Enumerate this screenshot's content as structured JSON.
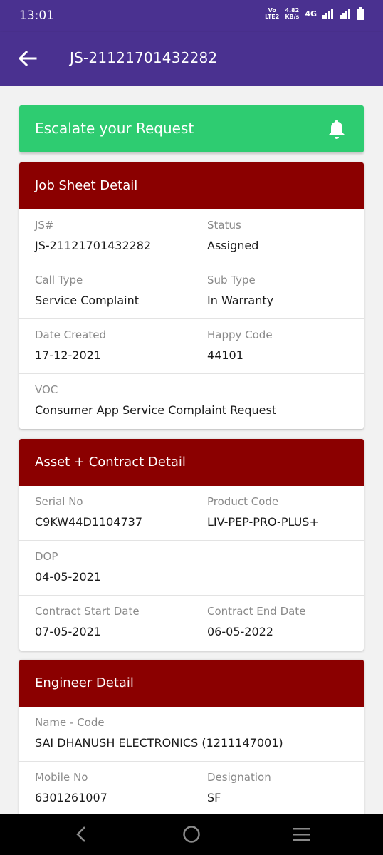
{
  "status_bar": {
    "time": "13:01",
    "volte_line1": "Vo",
    "volte_line2": "LTE2",
    "speed_value": "4.82",
    "speed_unit": "KB/s",
    "network": "4G"
  },
  "app_bar": {
    "title": "JS-21121701432282",
    "back_icon": "arrow-left-icon"
  },
  "escalate": {
    "label": "Escalate your Request",
    "icon": "bell-icon"
  },
  "job_sheet": {
    "header": "Job Sheet Detail",
    "rows": [
      [
        {
          "label": "JS#",
          "value": "JS-21121701432282"
        },
        {
          "label": "Status",
          "value": "Assigned"
        }
      ],
      [
        {
          "label": "Call Type",
          "value": "Service Complaint"
        },
        {
          "label": "Sub Type",
          "value": "In Warranty"
        }
      ],
      [
        {
          "label": "Date Created",
          "value": "17-12-2021"
        },
        {
          "label": "Happy Code",
          "value": "44101"
        }
      ],
      [
        {
          "label": "VOC",
          "value": "Consumer App Service Complaint Request"
        }
      ]
    ]
  },
  "asset_contract": {
    "header": "Asset + Contract Detail",
    "rows": [
      [
        {
          "label": "Serial No",
          "value": "C9KW44D1104737"
        },
        {
          "label": "Product Code",
          "value": "LIV-PEP-PRO-PLUS+"
        }
      ],
      [
        {
          "label": "DOP",
          "value": "04-05-2021"
        }
      ],
      [
        {
          "label": "Contract Start Date",
          "value": "07-05-2021"
        },
        {
          "label": "Contract End Date",
          "value": "06-05-2022"
        }
      ]
    ]
  },
  "engineer": {
    "header": "Engineer Detail",
    "rows": [
      [
        {
          "label": "Name - Code",
          "value": "SAI DHANUSH ELECTRONICS (1211147001)"
        }
      ],
      [
        {
          "label": "Mobile No",
          "value": "6301261007"
        },
        {
          "label": "Designation",
          "value": "SF"
        }
      ]
    ]
  },
  "nav_bar": {
    "back": "nav-back-icon",
    "home": "nav-home-icon",
    "menu": "nav-menu-icon"
  },
  "colors": {
    "primary": "#4a3190",
    "escalate": "#2ecc71",
    "card_header": "#8b0000"
  }
}
